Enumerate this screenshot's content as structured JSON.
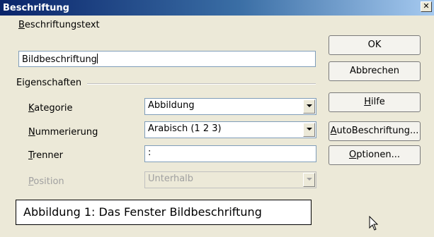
{
  "window": {
    "title": "Beschriftung",
    "close_glyph": "✕"
  },
  "caption_text": {
    "label": "Beschriftungstext",
    "value": "Bildbeschriftung"
  },
  "properties": {
    "heading": "Eigenschaften",
    "category": {
      "label": "Kategorie",
      "value": "Abbildung"
    },
    "numbering": {
      "label": "Nummerierung",
      "value": "Arabisch (1 2 3)"
    },
    "separator": {
      "label": "Trenner",
      "value": ":"
    },
    "position": {
      "label": "Position",
      "value": "Unterhalb"
    }
  },
  "preview_text": "Abbildung 1: Das Fenster Bildbeschriftung",
  "buttons": {
    "ok": "OK",
    "cancel": "Abbrechen",
    "help": "Hilfe",
    "autocaption": "AutoBeschriftung...",
    "options": "Optionen..."
  },
  "icons": {
    "close": "close-icon",
    "cursor": "mouse-pointer-icon",
    "dropdown": "chevron-down-icon"
  }
}
